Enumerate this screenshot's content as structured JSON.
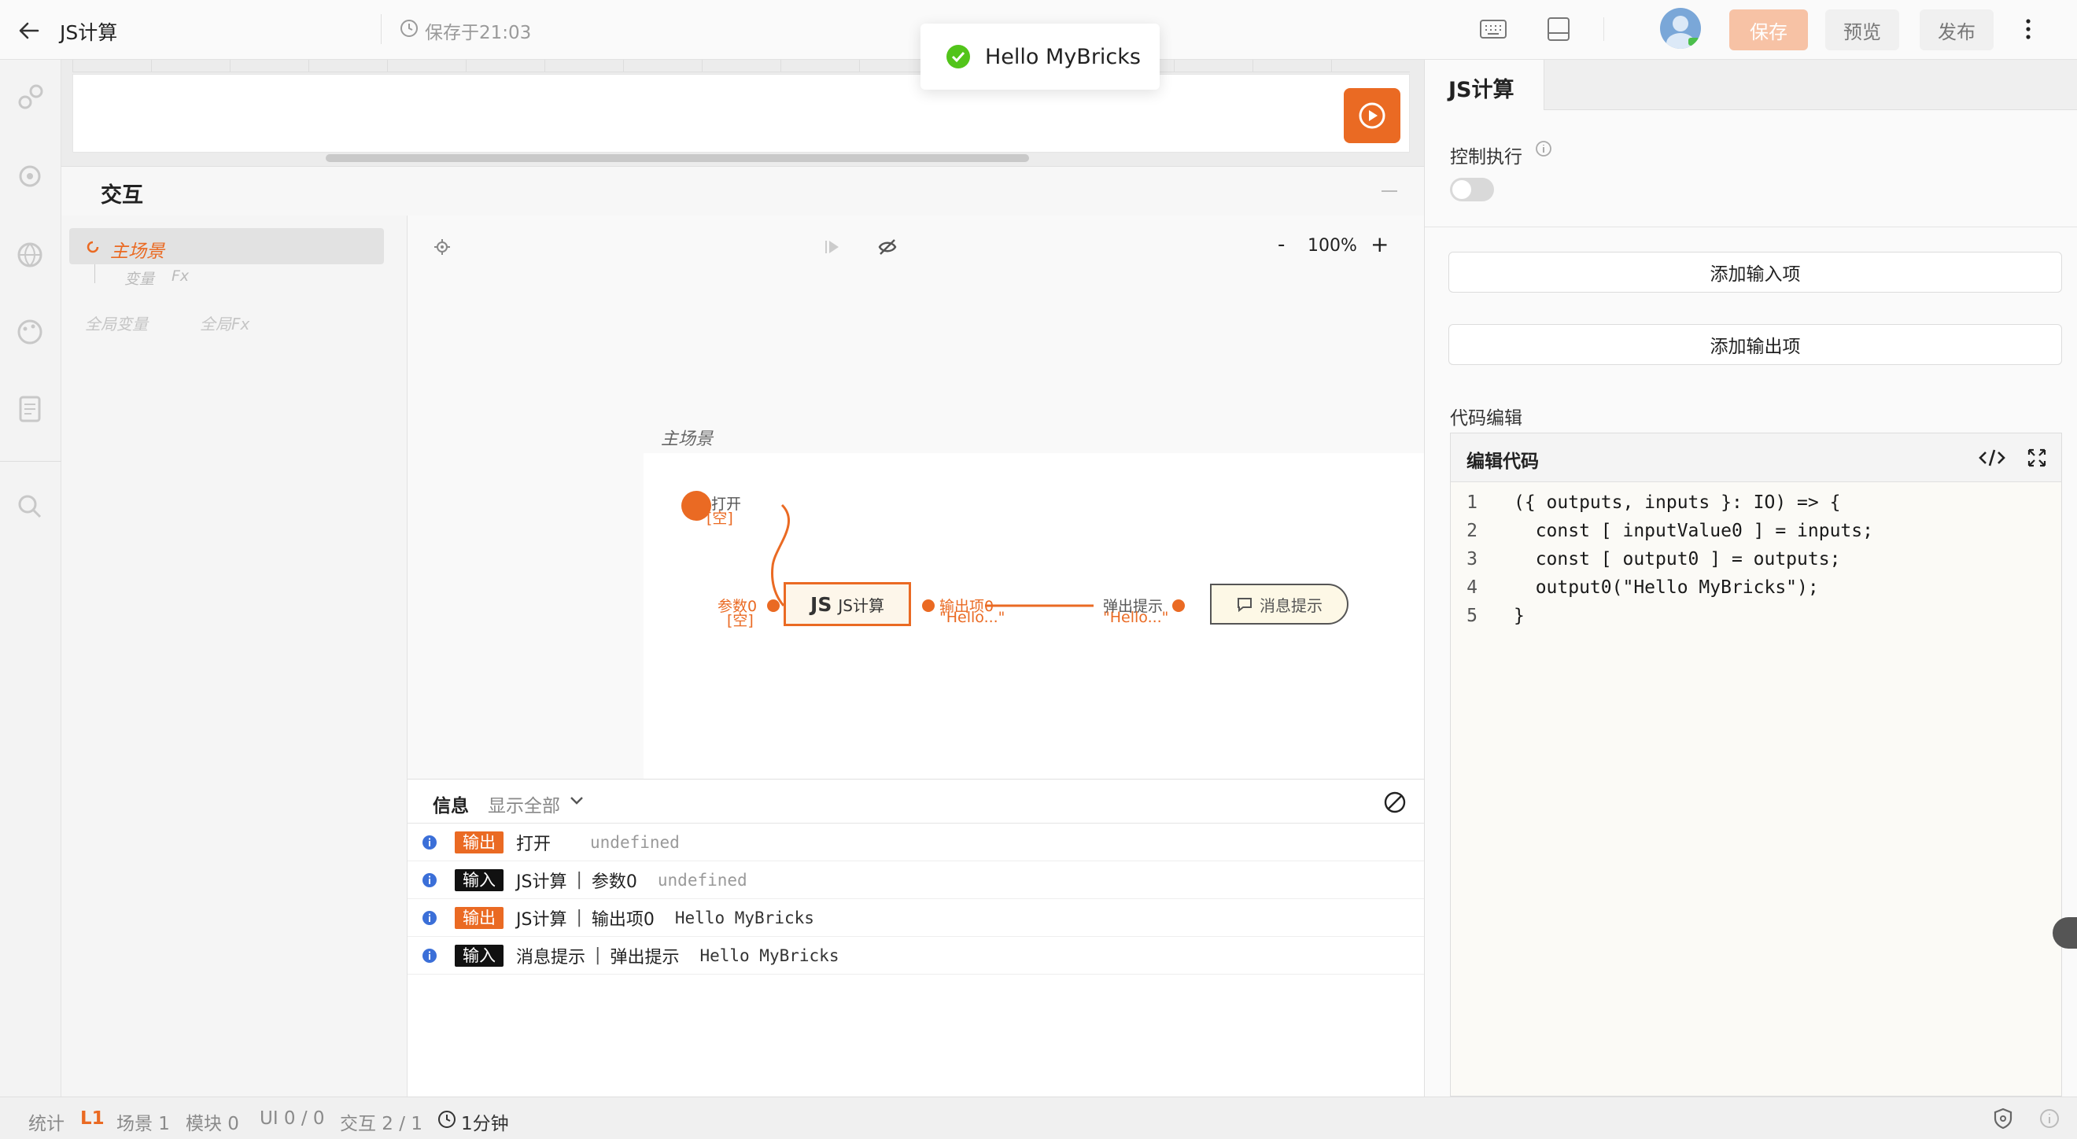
{
  "topbar": {
    "back_icon": "arrow-left-icon",
    "title": "JS计算",
    "save_status": "保存于21:03",
    "save_label": "保存",
    "preview_label": "预览",
    "publish_label": "发布"
  },
  "toast": {
    "message": "Hello MyBricks"
  },
  "interaction": {
    "header": "交互",
    "tree": {
      "scene": "主场景",
      "var": "变量",
      "fx": "Fx",
      "global_var": "全局变量",
      "global_fx": "全局Fx"
    },
    "toolbar": {
      "zoom": "100%",
      "zoom_minus": "-",
      "zoom_plus": "+"
    },
    "canvas": {
      "scene_title": "主场景",
      "open_label": "打开",
      "open_value": "[空]",
      "param_label": "参数0",
      "param_value": "[空]",
      "js_node": "JS计算",
      "js_prefix": "JS",
      "output_label": "输出项0",
      "output_value": "\"Hello...\"",
      "popup_label": "弹出提示",
      "popup_value": "\"Hello...\"",
      "msg_node": "消息提示"
    }
  },
  "console": {
    "title": "信息",
    "filter": "显示全部",
    "rows": [
      {
        "tag": "输出",
        "tag_type": "out",
        "target": "打开",
        "sep": "",
        "port": "",
        "value": "undefined"
      },
      {
        "tag": "输入",
        "tag_type": "in",
        "target": "JS计算",
        "sep": "|",
        "port": "参数0",
        "value": "undefined"
      },
      {
        "tag": "输出",
        "tag_type": "out",
        "target": "JS计算",
        "sep": "|",
        "port": "输出项0",
        "value": "Hello MyBricks"
      },
      {
        "tag": "输入",
        "tag_type": "in",
        "target": "消息提示",
        "sep": "|",
        "port": "弹出提示",
        "value": "Hello MyBricks"
      }
    ]
  },
  "panel": {
    "tab": "JS计算",
    "control_label": "控制执行",
    "add_input": "添加输入项",
    "add_output": "添加输出项",
    "code_section": "代码编辑",
    "editor_title": "编辑代码",
    "code_lines": [
      {
        "n": "1",
        "text": "({ outputs, inputs }: IO) => {"
      },
      {
        "n": "2",
        "text": "  const [ inputValue0 ] = inputs;"
      },
      {
        "n": "3",
        "text": "  const [ output0 ] = outputs;"
      },
      {
        "n": "4",
        "text": "  output0(\"Hello MyBricks\");"
      },
      {
        "n": "5",
        "text": "}"
      }
    ]
  },
  "statusbar": {
    "stats": "统计",
    "level": "L1",
    "scene": "场景 1",
    "module": "模块 0",
    "ui": "UI 0 / 0",
    "interact": "交互 2 / 1",
    "time": "1分钟"
  },
  "colors": {
    "accent": "#ea6a23",
    "save_bg": "#f7c2a5",
    "success": "#52c41a"
  }
}
